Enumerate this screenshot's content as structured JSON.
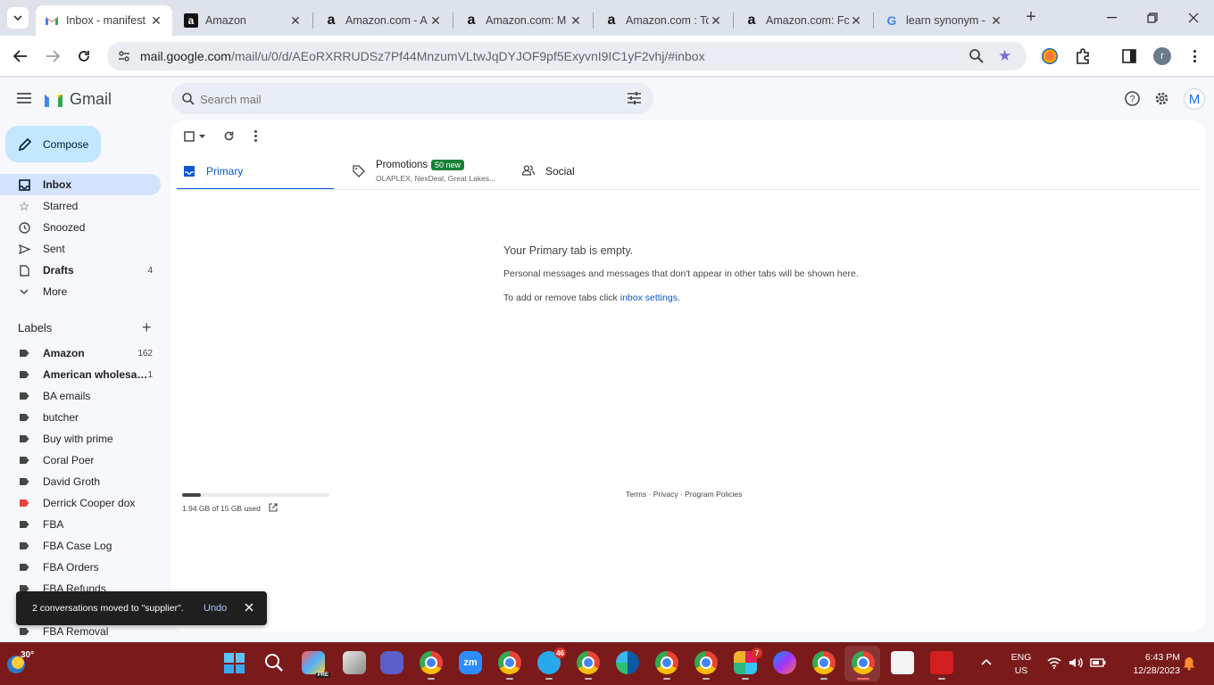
{
  "browser": {
    "tabs": [
      {
        "title": "Inbox - manifest",
        "favicon": "gmail-icon",
        "active": true
      },
      {
        "title": "Amazon",
        "favicon": "amazon-icon",
        "active": false
      },
      {
        "title": "Amazon.com - A",
        "favicon": "amazon-icon",
        "active": false
      },
      {
        "title": "Amazon.com: M",
        "favicon": "amazon-icon",
        "active": false
      },
      {
        "title": "Amazon.com : Tc",
        "favicon": "amazon-icon",
        "active": false
      },
      {
        "title": "Amazon.com: Fc",
        "favicon": "amazon-icon",
        "active": false
      },
      {
        "title": "learn synonym -",
        "favicon": "google-icon",
        "active": false
      }
    ],
    "url_host": "mail.google.com",
    "url_path": "/mail/u/0/d/AEoRXRRUDSz7Pf44MnzumVLtwJqDYJOF9pf5ExyvnI9IC1yF2vhj/#inbox",
    "profile_initial": "r"
  },
  "gmail": {
    "logo_text": "Gmail",
    "search_placeholder": "Search mail",
    "account_initial": "M",
    "compose_label": "Compose",
    "nav": [
      {
        "label": "Inbox",
        "count": "",
        "icon": "inbox-icon"
      },
      {
        "label": "Starred",
        "count": "",
        "icon": "star-icon"
      },
      {
        "label": "Snoozed",
        "count": "",
        "icon": "clock-icon"
      },
      {
        "label": "Sent",
        "count": "",
        "icon": "send-icon"
      },
      {
        "label": "Drafts",
        "count": "4",
        "icon": "draft-icon"
      },
      {
        "label": "More",
        "count": "",
        "icon": "chevron-down-icon"
      }
    ],
    "labels_heading": "Labels",
    "labels": [
      {
        "label": "Amazon",
        "count": "162",
        "color": "#444746",
        "bold": true
      },
      {
        "label": "American wholesal...",
        "count": "1",
        "color": "#444746",
        "bold": true
      },
      {
        "label": "BA emails",
        "count": "",
        "color": "#444746",
        "bold": false
      },
      {
        "label": "butcher",
        "count": "",
        "color": "#444746",
        "bold": false
      },
      {
        "label": "Buy with prime",
        "count": "",
        "color": "#444746",
        "bold": false
      },
      {
        "label": "Coral Poer",
        "count": "",
        "color": "#444746",
        "bold": false
      },
      {
        "label": "David Groth",
        "count": "",
        "color": "#444746",
        "bold": false
      },
      {
        "label": "Derrick Cooper dox",
        "count": "",
        "color": "#e8453c",
        "bold": false
      },
      {
        "label": "FBA",
        "count": "",
        "color": "#444746",
        "bold": false
      },
      {
        "label": "FBA Case Log",
        "count": "",
        "color": "#444746",
        "bold": false
      },
      {
        "label": "FBA Orders",
        "count": "",
        "color": "#444746",
        "bold": false
      },
      {
        "label": "FBA Refunds",
        "count": "",
        "color": "#444746",
        "bold": false
      },
      {
        "label": "FBA Removal",
        "count": "",
        "color": "#444746",
        "bold": false
      }
    ],
    "categories": {
      "primary": "Primary",
      "promotions": "Promotions",
      "promotions_badge": "50 new",
      "promotions_senders": "OLAPLEX, NexDeal, Great Lakes...",
      "social": "Social"
    },
    "empty": {
      "title": "Your Primary tab is empty.",
      "line1": "Personal messages and messages that don't appear in other tabs will be shown here.",
      "line2_prefix": "To add or remove tabs click ",
      "line2_link": "inbox settings",
      "line2_suffix": "."
    },
    "storage": {
      "text": "1.94 GB of 15 GB used",
      "used_fraction": 0.129
    },
    "footer": {
      "terms": "Terms",
      "sep": " · ",
      "privacy": "Privacy",
      "policies": "Program Policies"
    },
    "snackbar": {
      "message": "2 conversations moved to \"supplier\".",
      "undo": "Undo"
    },
    "accent": "#0b57d0",
    "selected_bg": "#d3e3fd"
  },
  "taskbar": {
    "weather_temp": "30°",
    "language_top": "ENG",
    "language_bottom": "US",
    "time": "6:43 PM",
    "date": "12/28/2023",
    "badges": {
      "telegram": "46",
      "slack": "7"
    },
    "zoom_label": "zm"
  }
}
